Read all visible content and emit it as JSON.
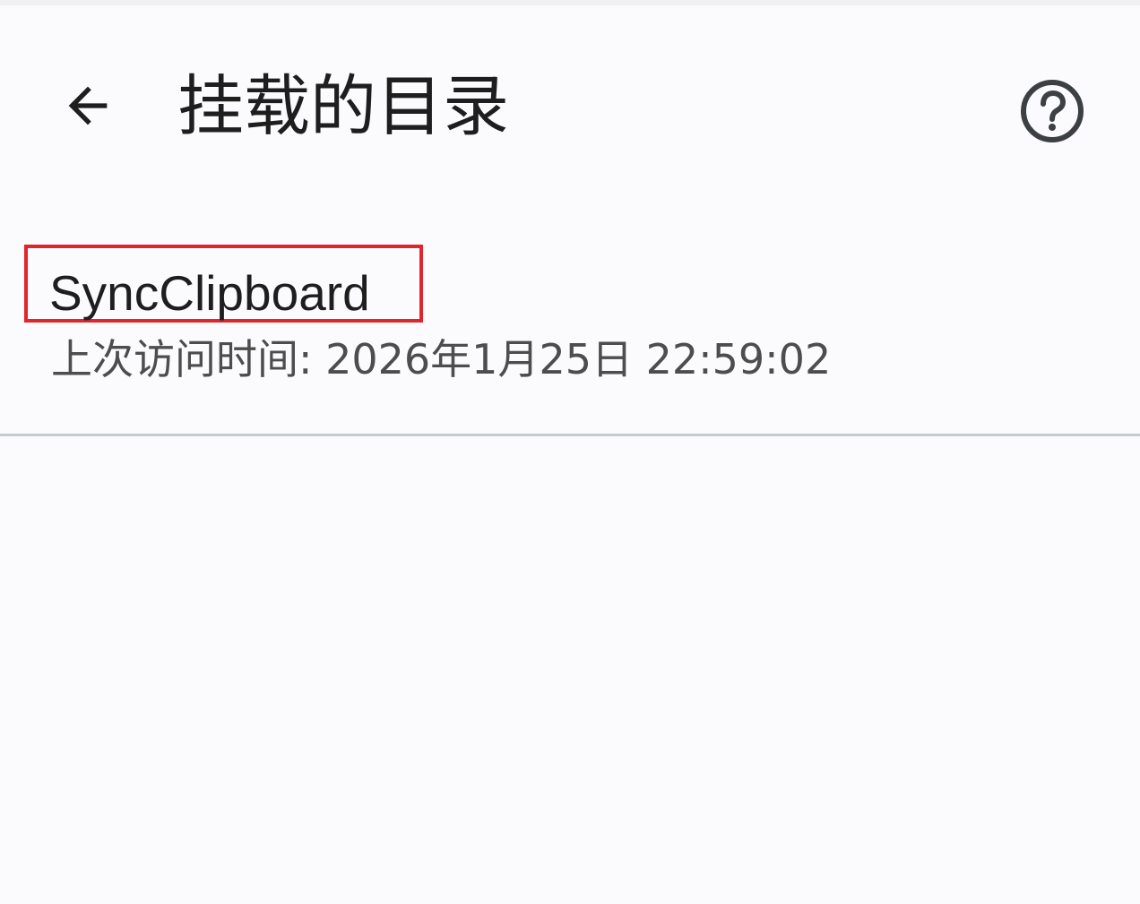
{
  "header": {
    "title": "挂载的目录",
    "back_icon": "arrow-left-icon",
    "help_icon": "help-circle-icon"
  },
  "directories": [
    {
      "name": "SyncClipboard",
      "subtitle": "上次访问时间: 2026年1月25日 22:59:02"
    }
  ],
  "colors": {
    "background": "#fbfbfd",
    "text_primary": "#1e1e1e",
    "text_secondary": "#4d4d4d",
    "highlight_border": "#e0252c",
    "divider": "#c6cbd0",
    "icon": "#3c4043"
  }
}
